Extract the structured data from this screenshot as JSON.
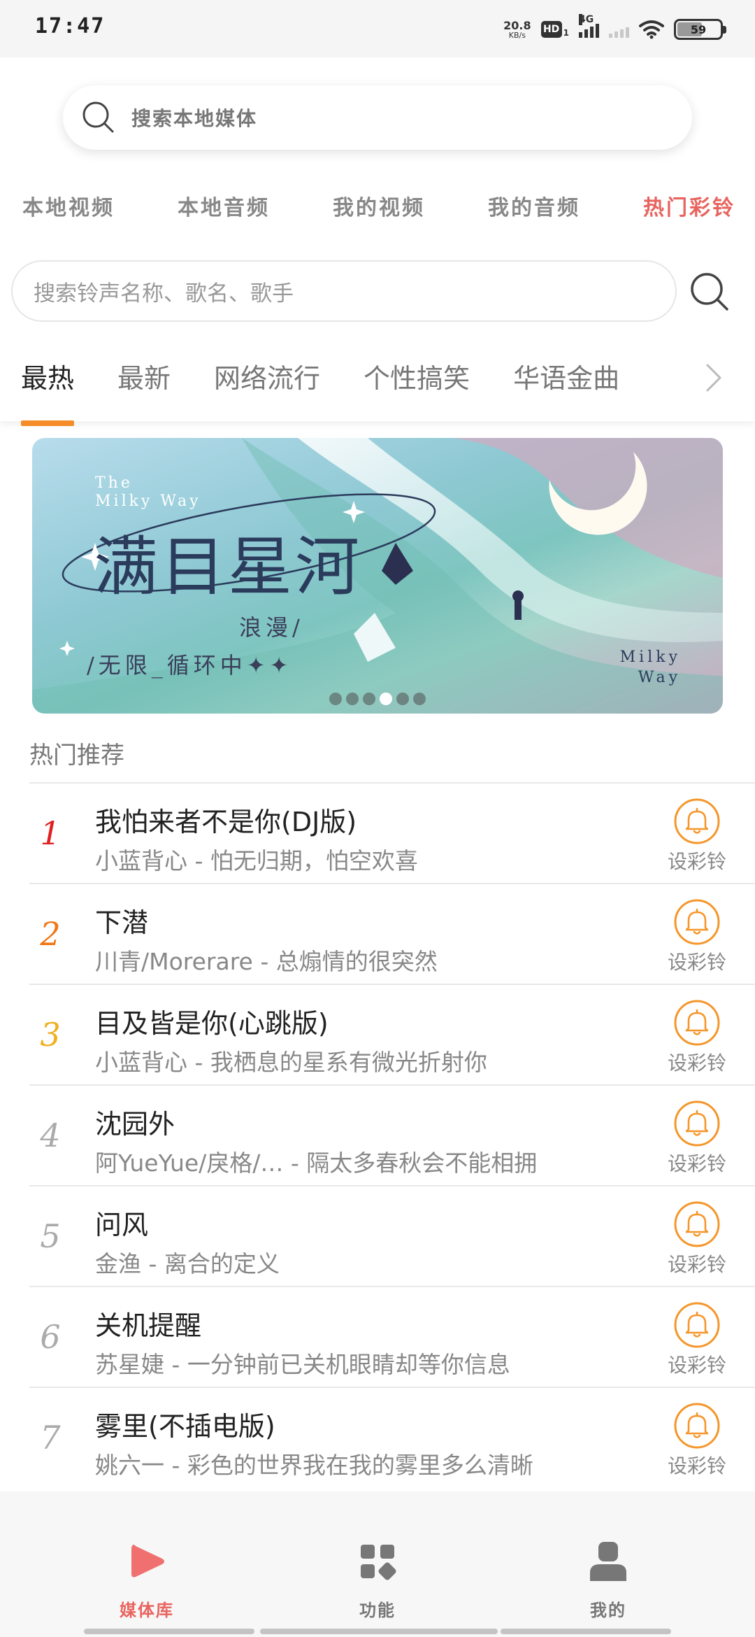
{
  "status_bar": {
    "time": "17:47",
    "net_speed_value": "20.8",
    "net_speed_unit": "KB/s",
    "hd_label": "HD",
    "sim_label": "1",
    "network_type": "4G",
    "battery_level": "59"
  },
  "top_search": {
    "placeholder": "搜索本地媒体"
  },
  "media_tabs": [
    {
      "label": "本地视频"
    },
    {
      "label": "本地音频"
    },
    {
      "label": "我的视频"
    },
    {
      "label": "我的音频"
    },
    {
      "label": "热门彩铃",
      "active": true
    }
  ],
  "ring_search": {
    "placeholder": "搜索铃声名称、歌名、歌手"
  },
  "category_tabs": [
    {
      "label": "最热",
      "active": true
    },
    {
      "label": "最新"
    },
    {
      "label": "网络流行"
    },
    {
      "label": "个性搞笑"
    },
    {
      "label": "华语金曲"
    }
  ],
  "banner": {
    "en_top_line1": "The",
    "en_top_line2": "Milky Way",
    "title": "满目星河",
    "sub_line1": "浪漫/",
    "sub_line2": "/无限_循环中✦✦",
    "en_bottom_line1": "Milky",
    "en_bottom_line2": "Way",
    "dot_count": 6,
    "active_dot": 4
  },
  "section_title": "热门推荐",
  "ring_button_label": "设彩铃",
  "songs": [
    {
      "rank": "1",
      "title": "我怕来者不是你(DJ版)",
      "meta": "小蓝背心 - 怕无归期，怕空欢喜"
    },
    {
      "rank": "2",
      "title": "下潜",
      "meta": "川青/Morerare - 总煽情的很突然"
    },
    {
      "rank": "3",
      "title": "目及皆是你(心跳版)",
      "meta": "小蓝背心 - 我栖息的星系有微光折射你"
    },
    {
      "rank": "4",
      "title": "沈园外",
      "meta": "阿YueYue/戾格/…    - 隔太多春秋会不能相拥"
    },
    {
      "rank": "5",
      "title": "问风",
      "meta": "金渔 - 离合的定义"
    },
    {
      "rank": "6",
      "title": "关机提醒",
      "meta": "苏星婕 - 一分钟前已关机眼睛却等你信息"
    },
    {
      "rank": "7",
      "title": "雾里(不插电版)",
      "meta": "姚六一 - 彩色的世界我在我的雾里多么清晰"
    }
  ],
  "bottom_nav": [
    {
      "label": "媒体库",
      "icon": "play-icon",
      "active": true
    },
    {
      "label": "功能",
      "icon": "apps-grid-icon"
    },
    {
      "label": "我的",
      "icon": "user-icon"
    }
  ],
  "colors": {
    "accent_red": "#e8645f",
    "tab_underline": "#f58c29",
    "rank1": "#e02020",
    "rank2": "#f07818",
    "rank3": "#f0b020",
    "bell_orange": "#f5962a"
  }
}
